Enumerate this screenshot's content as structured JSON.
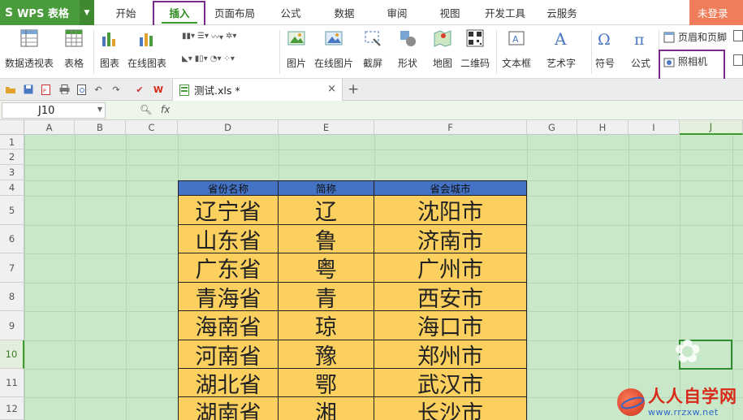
{
  "app": {
    "name": "WPS 表格",
    "logo_glyph": "S"
  },
  "menu": {
    "tabs": [
      {
        "label": "开始"
      },
      {
        "label": "插入",
        "active": true
      },
      {
        "label": "页面布局"
      },
      {
        "label": "公式"
      },
      {
        "label": "数据"
      },
      {
        "label": "审阅"
      },
      {
        "label": "视图"
      },
      {
        "label": "开发工具"
      },
      {
        "label": "云服务"
      }
    ],
    "login": "未登录"
  },
  "ribbon": {
    "pivot": "数据透视表",
    "table": "表格",
    "chart": "图表",
    "online_chart": "在线图表",
    "picture": "图片",
    "online_picture": "在线图片",
    "screenshot": "截屏",
    "shapes": "形状",
    "map": "地图",
    "qrcode": "二维码",
    "textbox": "文本框",
    "wordart": "艺术字",
    "symbol": "符号",
    "formula": "公式",
    "header_footer": "页眉和页脚",
    "camera": "照相机"
  },
  "document": {
    "tab_name": "测试.xls *"
  },
  "formula_bar": {
    "cell_ref": "J10",
    "fx": "fx"
  },
  "columns": [
    "A",
    "B",
    "C",
    "D",
    "E",
    "F",
    "G",
    "H",
    "I",
    "J"
  ],
  "rows": [
    "1",
    "2",
    "3",
    "4",
    "5",
    "6",
    "7",
    "8",
    "9",
    "10",
    "11",
    "12"
  ],
  "table": {
    "headers": [
      "省份名称",
      "简称",
      "省会城市"
    ],
    "rows": [
      [
        "辽宁省",
        "辽",
        "沈阳市"
      ],
      [
        "山东省",
        "鲁",
        "济南市"
      ],
      [
        "广东省",
        "粤",
        "广州市"
      ],
      [
        "青海省",
        "青",
        "西安市"
      ],
      [
        "海南省",
        "琼",
        "海口市"
      ],
      [
        "河南省",
        "豫",
        "郑州市"
      ],
      [
        "湖北省",
        "鄂",
        "武汉市"
      ],
      [
        "湖南省",
        "湘",
        "长沙市"
      ]
    ]
  },
  "watermark": {
    "title": "人人自学网",
    "url": "www.rrzxw.net"
  },
  "colors": {
    "accent": "#4a9b3b",
    "header_fill": "#4472c4",
    "body_fill": "#fcd05f",
    "grid_bg": "#c9e8c9",
    "highlight": "#7a2a8c"
  }
}
